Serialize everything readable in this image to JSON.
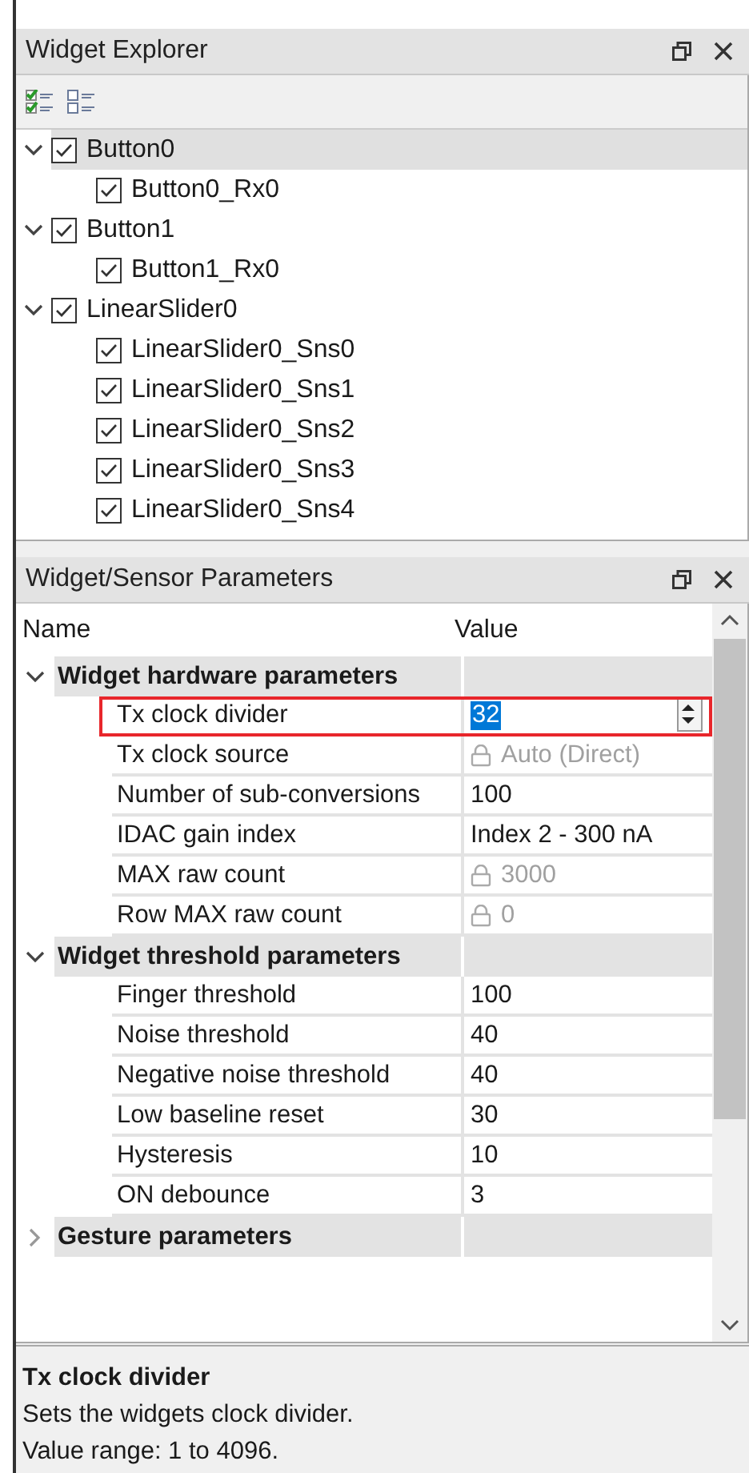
{
  "explorer": {
    "title": "Widget Explorer",
    "tree": [
      {
        "label": "Button0",
        "checked": true,
        "expanded": true,
        "selected": true,
        "children": [
          {
            "label": "Button0_Rx0",
            "checked": true,
            "selected": false
          }
        ]
      },
      {
        "label": "Button1",
        "checked": true,
        "expanded": true,
        "selected": false,
        "children": [
          {
            "label": "Button1_Rx0",
            "checked": true,
            "selected": false
          }
        ]
      },
      {
        "label": "LinearSlider0",
        "checked": true,
        "expanded": true,
        "selected": false,
        "children": [
          {
            "label": "LinearSlider0_Sns0",
            "checked": true,
            "selected": false
          },
          {
            "label": "LinearSlider0_Sns1",
            "checked": true,
            "selected": false
          },
          {
            "label": "LinearSlider0_Sns2",
            "checked": true,
            "selected": false
          },
          {
            "label": "LinearSlider0_Sns3",
            "checked": true,
            "selected": false
          },
          {
            "label": "LinearSlider0_Sns4",
            "checked": true,
            "selected": false
          }
        ]
      }
    ]
  },
  "parameters": {
    "title": "Widget/Sensor Parameters",
    "columns": [
      "Name",
      "Value"
    ],
    "groups": [
      {
        "label": "Widget hardware parameters",
        "expanded": true,
        "rows": [
          {
            "name": "Tx clock divider",
            "value": "32",
            "locked": false,
            "selected": true
          },
          {
            "name": "Tx clock source",
            "value": "Auto (Direct)",
            "locked": true,
            "selected": false
          },
          {
            "name": "Number of sub-conversions",
            "value": "100",
            "locked": false,
            "selected": false
          },
          {
            "name": "IDAC gain index",
            "value": "Index 2 - 300 nA",
            "locked": false,
            "selected": false
          },
          {
            "name": "MAX raw count",
            "value": "3000",
            "locked": true,
            "selected": false
          },
          {
            "name": "Row MAX raw count",
            "value": "0",
            "locked": true,
            "selected": false
          }
        ]
      },
      {
        "label": "Widget threshold parameters",
        "expanded": true,
        "rows": [
          {
            "name": "Finger threshold",
            "value": "100",
            "locked": false,
            "selected": false
          },
          {
            "name": "Noise threshold",
            "value": "40",
            "locked": false,
            "selected": false
          },
          {
            "name": "Negative noise threshold",
            "value": "40",
            "locked": false,
            "selected": false
          },
          {
            "name": "Low baseline reset",
            "value": "30",
            "locked": false,
            "selected": false
          },
          {
            "name": "Hysteresis",
            "value": "10",
            "locked": false,
            "selected": false
          },
          {
            "name": "ON debounce",
            "value": "3",
            "locked": false,
            "selected": false
          }
        ]
      },
      {
        "label": "Gesture parameters",
        "expanded": false
      }
    ]
  },
  "description": {
    "title": "Tx clock divider",
    "lines": [
      "Sets the widgets clock divider.",
      "Value range: 1 to 4096."
    ]
  }
}
